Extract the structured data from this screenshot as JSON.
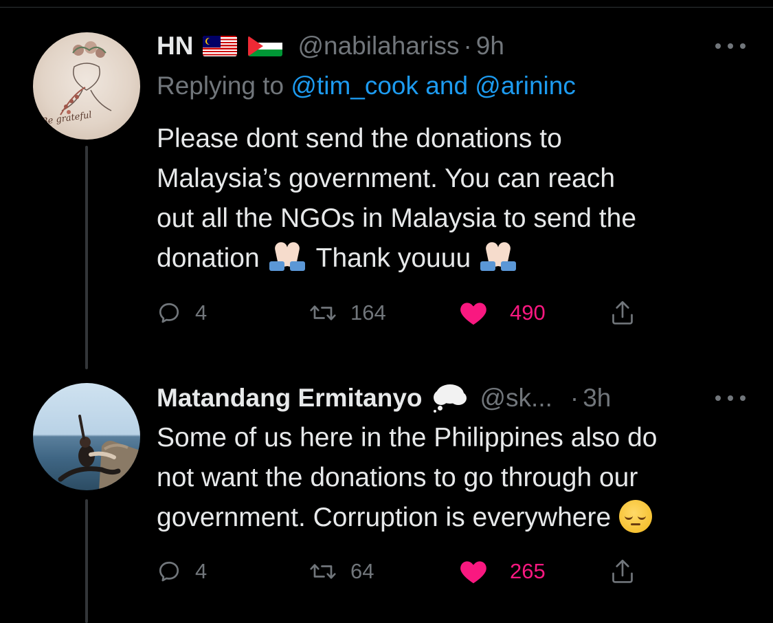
{
  "tweets": [
    {
      "display_name": "HN",
      "badges": [
        "flag-malaysia-icon",
        "flag-palestine-icon"
      ],
      "handle": "@nabilahariss",
      "separator": "·",
      "time": "9h",
      "replying_prefix": "Replying to",
      "replying_to": "@tim_cook and @arininc",
      "avatar_text": "Be grateful",
      "body_lines": [
        "Please dont send the donations to",
        "Malaysia’s government. You can reach",
        "out all the NGOs in Malaysia to send the"
      ],
      "body_last_part1": "donation",
      "body_last_part2": "Thank youuu",
      "actions": {
        "replies": "4",
        "retweets": "164",
        "likes": "490"
      }
    },
    {
      "display_name": "Matandang Ermitanyo",
      "badges": [
        "thought-balloon-icon"
      ],
      "handle": "@sk...",
      "separator": "·",
      "time": "3h",
      "body_lines": [
        "Some of us here in the Philippines also do",
        "not want the donations to go through our"
      ],
      "body_last": "government. Corruption is everywhere",
      "actions": {
        "replies": "4",
        "retweets": "64",
        "likes": "265"
      }
    }
  ],
  "colors": {
    "background": "#000000",
    "text": "#e7e9ea",
    "secondary": "#71767b",
    "link": "#1d9bf0",
    "like": "#f91880"
  }
}
